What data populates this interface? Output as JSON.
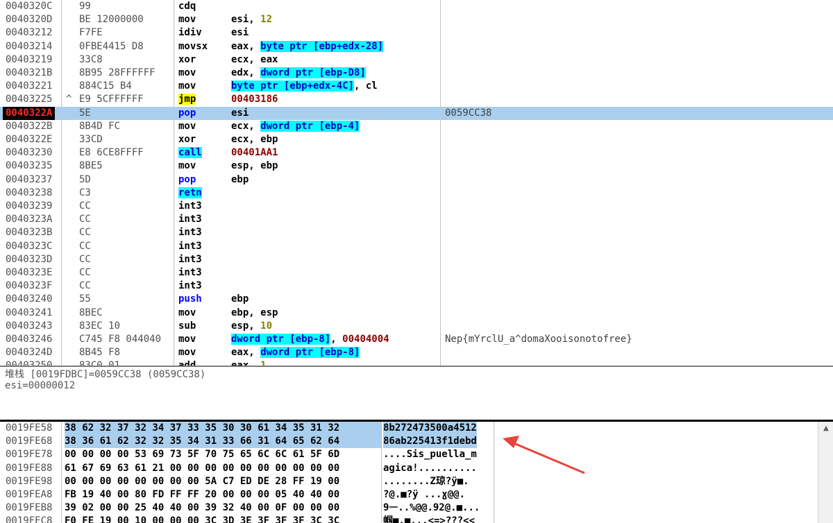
{
  "disasm": {
    "rows": [
      {
        "addr": "0040320C",
        "jm": "",
        "hex": "99",
        "mn": "cdq",
        "ops": [],
        "cm": ""
      },
      {
        "addr": "0040320D",
        "jm": "",
        "hex": "BE 12000000",
        "mn": "mov",
        "ops": [
          {
            "t": "esi, "
          },
          {
            "t": "12",
            "c": "num"
          }
        ],
        "cm": ""
      },
      {
        "addr": "00403212",
        "jm": "",
        "hex": "F7FE",
        "mn": "idiv",
        "ops": [
          {
            "t": "esi"
          }
        ],
        "cm": ""
      },
      {
        "addr": "00403214",
        "jm": "",
        "hex": "0FBE4415 D8",
        "mn": "movsx",
        "ops": [
          {
            "t": "eax, "
          },
          {
            "t": "byte ptr [ebp+edx-28]",
            "c": "mem"
          }
        ],
        "cm": ""
      },
      {
        "addr": "00403219",
        "jm": "",
        "hex": "33C8",
        "mn": "xor",
        "ops": [
          {
            "t": "ecx, eax"
          }
        ],
        "cm": ""
      },
      {
        "addr": "0040321B",
        "jm": "",
        "hex": "8B95 28FFFFFF",
        "mn": "mov",
        "ops": [
          {
            "t": "edx, "
          },
          {
            "t": "dword ptr [ebp-D8]",
            "c": "mem"
          }
        ],
        "cm": ""
      },
      {
        "addr": "00403221",
        "jm": "",
        "hex": "884C15 B4",
        "mn": "mov",
        "ops": [
          {
            "t": "byte ptr [ebp+edx-4C]",
            "c": "mem"
          },
          {
            "t": ", cl"
          }
        ],
        "cm": ""
      },
      {
        "addr": "00403225",
        "jm": "^",
        "hex": "E9 5CFFFFFF",
        "mn": "jmp",
        "mnc": "jmp",
        "ops": [
          {
            "t": "00403186",
            "c": "addr"
          }
        ],
        "cm": ""
      },
      {
        "addr": "0040322A",
        "jm": "",
        "hex": "5E",
        "mn": "pop",
        "mnc": "blue",
        "ops": [
          {
            "t": "esi"
          }
        ],
        "cm": "0059CC38",
        "sel": true
      },
      {
        "addr": "0040322B",
        "jm": "",
        "hex": "8B4D FC",
        "mn": "mov",
        "ops": [
          {
            "t": "ecx, "
          },
          {
            "t": "dword ptr [ebp-4]",
            "c": "mem"
          }
        ],
        "cm": ""
      },
      {
        "addr": "0040322E",
        "jm": "",
        "hex": "33CD",
        "mn": "xor",
        "ops": [
          {
            "t": "ecx, ebp"
          }
        ],
        "cm": ""
      },
      {
        "addr": "00403230",
        "jm": "",
        "hex": "E8 6CE8FFFF",
        "mn": "call",
        "mnc": "call",
        "ops": [
          {
            "t": "00401AA1",
            "c": "addr"
          }
        ],
        "cm": ""
      },
      {
        "addr": "00403235",
        "jm": "",
        "hex": "8BE5",
        "mn": "mov",
        "ops": [
          {
            "t": "esp, ebp"
          }
        ],
        "cm": ""
      },
      {
        "addr": "00403237",
        "jm": "",
        "hex": "5D",
        "mn": "pop",
        "mnc": "blue",
        "ops": [
          {
            "t": "ebp"
          }
        ],
        "cm": ""
      },
      {
        "addr": "00403238",
        "jm": "",
        "hex": "C3",
        "mn": "retn",
        "mnc": "call",
        "ops": [],
        "cm": ""
      },
      {
        "addr": "00403239",
        "jm": "",
        "hex": "CC",
        "mn": "int3",
        "ops": [],
        "cm": ""
      },
      {
        "addr": "0040323A",
        "jm": "",
        "hex": "CC",
        "mn": "int3",
        "ops": [],
        "cm": ""
      },
      {
        "addr": "0040323B",
        "jm": "",
        "hex": "CC",
        "mn": "int3",
        "ops": [],
        "cm": ""
      },
      {
        "addr": "0040323C",
        "jm": "",
        "hex": "CC",
        "mn": "int3",
        "ops": [],
        "cm": ""
      },
      {
        "addr": "0040323D",
        "jm": "",
        "hex": "CC",
        "mn": "int3",
        "ops": [],
        "cm": ""
      },
      {
        "addr": "0040323E",
        "jm": "",
        "hex": "CC",
        "mn": "int3",
        "ops": [],
        "cm": ""
      },
      {
        "addr": "0040323F",
        "jm": "",
        "hex": "CC",
        "mn": "int3",
        "ops": [],
        "cm": ""
      },
      {
        "addr": "00403240",
        "jm": "",
        "hex": "55",
        "mn": "push",
        "mnc": "blue",
        "ops": [
          {
            "t": "ebp"
          }
        ],
        "cm": ""
      },
      {
        "addr": "00403241",
        "jm": "",
        "hex": "8BEC",
        "mn": "mov",
        "ops": [
          {
            "t": "ebp, esp"
          }
        ],
        "cm": ""
      },
      {
        "addr": "00403243",
        "jm": "",
        "hex": "83EC 10",
        "mn": "sub",
        "ops": [
          {
            "t": "esp, "
          },
          {
            "t": "10",
            "c": "num"
          }
        ],
        "cm": ""
      },
      {
        "addr": "00403246",
        "jm": "",
        "hex": "C745 F8 044040",
        "mn": "mov",
        "ops": [
          {
            "t": "dword ptr [ebp-8]",
            "c": "mem"
          },
          {
            "t": ", "
          },
          {
            "t": "00404004",
            "c": "addr"
          }
        ],
        "cm": "Nep{mYrclU_a^domaXooisonotofree}"
      },
      {
        "addr": "0040324D",
        "jm": "",
        "hex": "8B45 F8",
        "mn": "mov",
        "ops": [
          {
            "t": "eax, "
          },
          {
            "t": "dword ptr [ebp-8]",
            "c": "mem"
          }
        ],
        "cm": ""
      },
      {
        "addr": "00403250",
        "jm": "",
        "hex": "83C0 01",
        "mn": "add",
        "ops": [
          {
            "t": "eax, "
          },
          {
            "t": "1",
            "c": "num"
          }
        ],
        "cm": ""
      }
    ]
  },
  "info": {
    "line1": "堆栈 [0019FDBC]=0059CC38 (0059CC38)",
    "line2": "esi=00000012"
  },
  "dump": {
    "rows": [
      {
        "addr": "0019FE58",
        "hex": "38 62 32 37 32 34 37 33 35 30 30 61 34 35 31 32",
        "ascii": "8b272473500a4512",
        "hl": true
      },
      {
        "addr": "0019FE68",
        "hex": "38 36 61 62 32 32 35 34 31 33 66 31 64 65 62 64",
        "ascii": "86ab225413f1debd",
        "hl": true
      },
      {
        "addr": "0019FE78",
        "hex": "00 00 00 00 53 69 73 5F 70 75 65 6C 6C 61 5F 6D",
        "ascii": "....Sis_puella_m",
        "hl": false
      },
      {
        "addr": "0019FE88",
        "hex": "61 67 69 63 61 21 00 00 00 00 00 00 00 00 00 00",
        "ascii": "agica!..........",
        "hl": false
      },
      {
        "addr": "0019FE98",
        "hex": "00 00 00 00 00 00 00 00 5A C7 ED DE 28 FF 19 00",
        "ascii": "........Z琼?ÿ■.",
        "hl": false
      },
      {
        "addr": "0019FEA8",
        "hex": "FB 19 40 00 80 FD FF FF 20 00 00 00 05 40 40 00",
        "ascii": "?@.■?ÿ ...ɣ@@.",
        "hl": false
      },
      {
        "addr": "0019FEB8",
        "hex": "39 02 00 00 25 40 40 00 39 32 40 00 0F 00 00 00",
        "ascii": "9ᅳ..%@@.92@.■...",
        "hl": false
      },
      {
        "addr": "0019FEC8",
        "hex": "F0 FE 19 00 10 00 00 00 3C 3D 3E 3F 3F 3F 3C 3C",
        "ascii": "帼■.■...<=>???<<",
        "hl": false
      }
    ]
  },
  "icons": {
    "scroll_up": "scroll-up-arrow-icon",
    "annotation": "red-arrow-annotation"
  },
  "colors": {
    "selection": "#aacfee",
    "operand_highlight": "#00ffff",
    "jump_highlight": "#ffff00",
    "arrow": "#e8443a"
  }
}
